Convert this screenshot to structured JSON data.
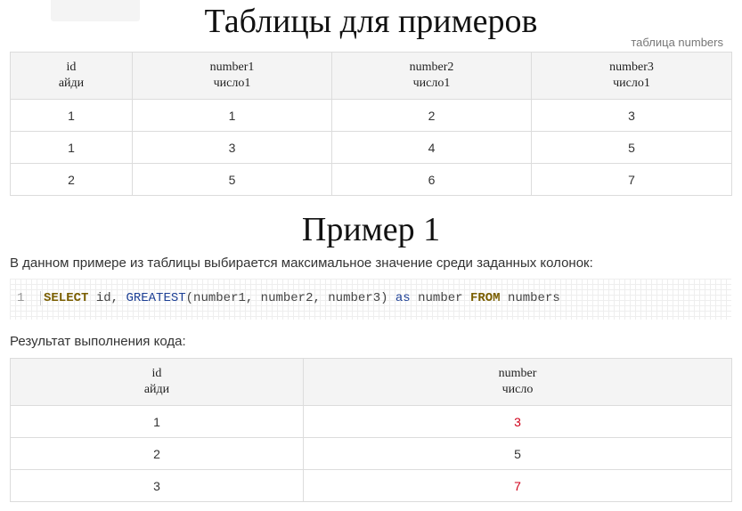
{
  "section1": {
    "title": "Таблицы для примеров",
    "caption": "таблица numbers",
    "headers": [
      {
        "name": "id",
        "sub": "айди"
      },
      {
        "name": "number1",
        "sub": "число1"
      },
      {
        "name": "number2",
        "sub": "число1"
      },
      {
        "name": "number3",
        "sub": "число1"
      }
    ],
    "rows": [
      [
        "1",
        "1",
        "2",
        "3"
      ],
      [
        "1",
        "3",
        "4",
        "5"
      ],
      [
        "2",
        "5",
        "6",
        "7"
      ]
    ]
  },
  "section2": {
    "title": "Пример 1",
    "description": "В данном примере из таблицы выбирается максимальное значение среди заданных колонок:",
    "code": {
      "line_number": "1",
      "kw_select": "SELECT",
      "part1": " id, ",
      "fn_greatest": "GREATEST",
      "part2": "(number1, number2, number3) ",
      "kw_as": "as",
      "part3": " number ",
      "kw_from": "FROM",
      "part4": " numbers"
    },
    "result_label": "Результат выполнения кода:",
    "headers": [
      {
        "name": "id",
        "sub": "айди"
      },
      {
        "name": "number",
        "sub": "число"
      }
    ],
    "rows": [
      [
        "1",
        "3"
      ],
      [
        "2",
        "5"
      ],
      [
        "3",
        "7"
      ]
    ],
    "highlight_color": "#d0021b"
  }
}
